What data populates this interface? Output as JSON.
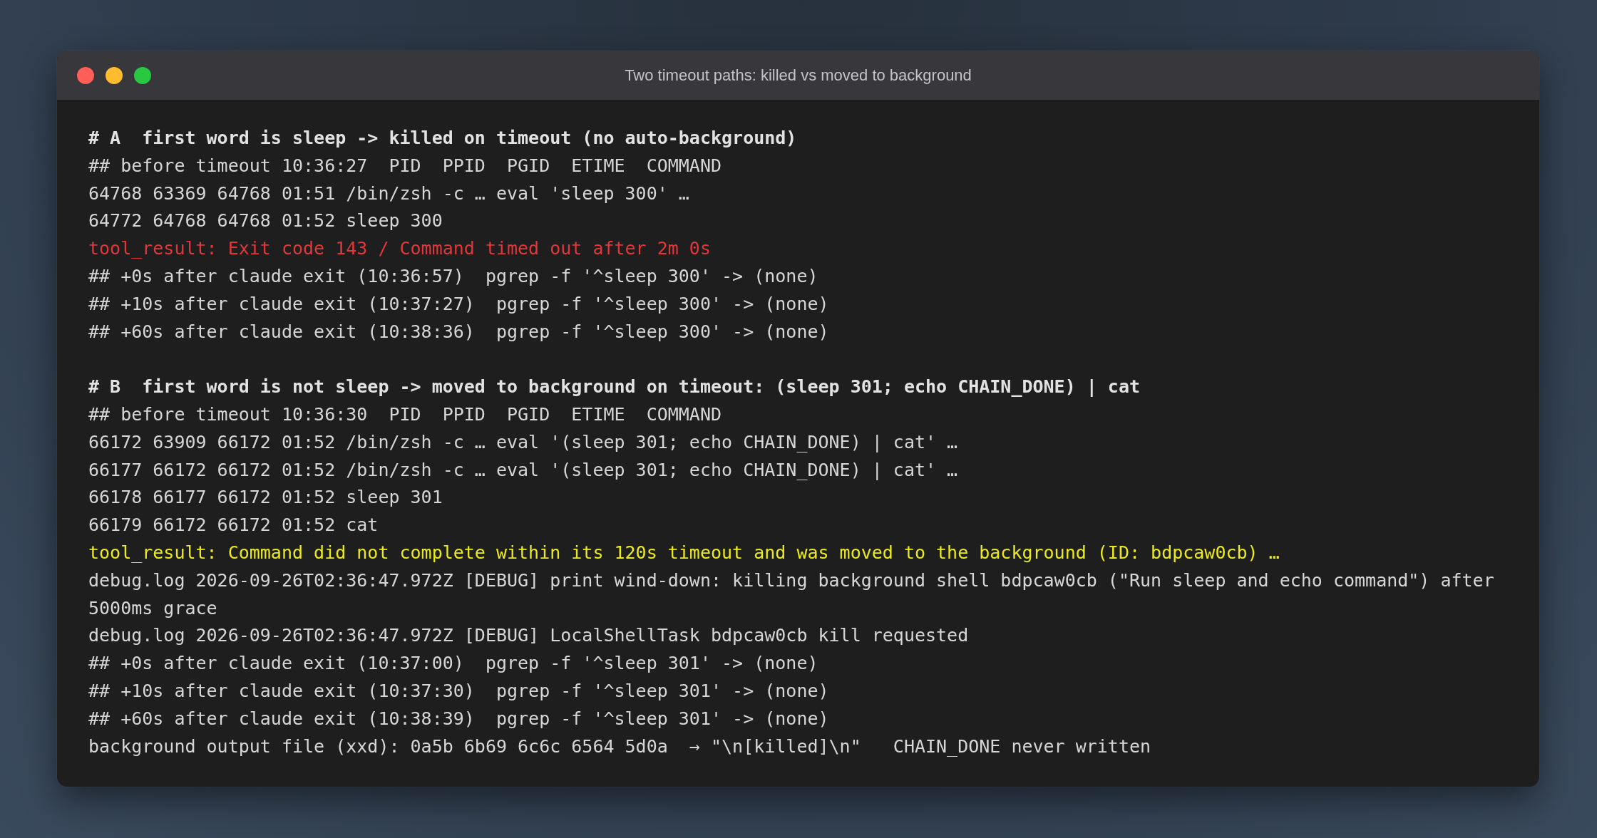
{
  "window": {
    "title": "Two timeout paths: killed vs moved to background"
  },
  "sections": [
    {
      "heading": "# A  first word is sleep -> killed on timeout (no auto-background)",
      "lines": [
        {
          "kind": "output",
          "text": "## before timeout 10:36:27  PID  PPID  PGID  ETIME  COMMAND"
        },
        {
          "kind": "output",
          "text": "64768 63369 64768 01:51 /bin/zsh -c … eval 'sleep 300' …"
        },
        {
          "kind": "output",
          "text": "64772 64768 64768 01:52 sleep 300"
        },
        {
          "kind": "error",
          "text": "tool_result: Exit code 143 / Command timed out after 2m 0s"
        },
        {
          "kind": "output",
          "text": "## +0s after claude exit (10:36:57)  pgrep -f '^sleep 300' -> (none)"
        },
        {
          "kind": "output",
          "text": "## +10s after claude exit (10:37:27)  pgrep -f '^sleep 300' -> (none)"
        },
        {
          "kind": "output",
          "text": "## +60s after claude exit (10:38:36)  pgrep -f '^sleep 300' -> (none)"
        }
      ]
    },
    {
      "heading": "# B  first word is not sleep -> moved to background on timeout: (sleep 301; echo CHAIN_DONE) | cat",
      "lines": [
        {
          "kind": "output",
          "text": "## before timeout 10:36:30  PID  PPID  PGID  ETIME  COMMAND"
        },
        {
          "kind": "output",
          "text": "66172 63909 66172 01:52 /bin/zsh -c … eval '(sleep 301; echo CHAIN_DONE) | cat' …"
        },
        {
          "kind": "output",
          "text": "66177 66172 66172 01:52 /bin/zsh -c … eval '(sleep 301; echo CHAIN_DONE) | cat' …"
        },
        {
          "kind": "output",
          "text": "66178 66177 66172 01:52 sleep 301"
        },
        {
          "kind": "output",
          "text": "66179 66172 66172 01:52 cat"
        },
        {
          "kind": "warning",
          "text": "tool_result: Command did not complete within its 120s timeout and was moved to the background (ID: bdpcaw0cb) …"
        },
        {
          "kind": "output",
          "text": "debug.log 2026-09-26T02:36:47.972Z [DEBUG] print wind-down: killing background shell bdpcaw0cb (\"Run sleep and echo command\") after 5000ms grace"
        },
        {
          "kind": "output",
          "text": "debug.log 2026-09-26T02:36:47.972Z [DEBUG] LocalShellTask bdpcaw0cb kill requested"
        },
        {
          "kind": "output",
          "text": "## +0s after claude exit (10:37:00)  pgrep -f '^sleep 301' -> (none)"
        },
        {
          "kind": "output",
          "text": "## +10s after claude exit (10:37:30)  pgrep -f '^sleep 301' -> (none)"
        },
        {
          "kind": "output",
          "text": "## +60s after claude exit (10:38:39)  pgrep -f '^sleep 301' -> (none)"
        },
        {
          "kind": "output",
          "text": "background output file (xxd): 0a5b 6b69 6c6c 6564 5d0a  → \"\\n[killed]\\n\"   CHAIN_DONE never written"
        }
      ]
    }
  ]
}
